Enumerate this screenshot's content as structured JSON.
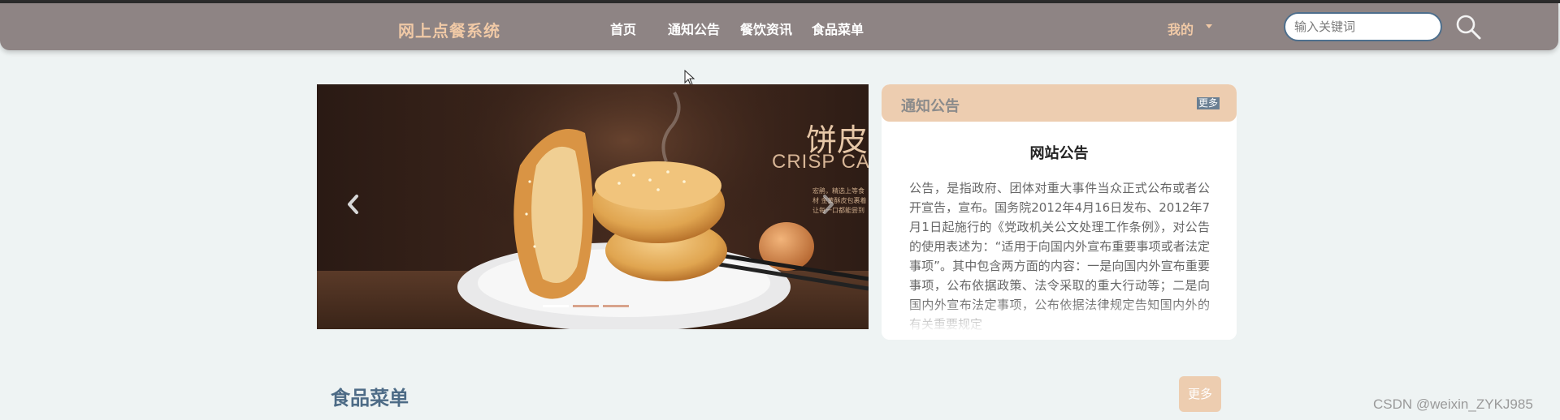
{
  "navbar": {
    "brand": "网上点餐系统",
    "items": [
      {
        "label": "首页"
      },
      {
        "label": "通知公告"
      },
      {
        "label": "餐饮资讯"
      },
      {
        "label": "食品菜单"
      }
    ],
    "user_menu": "我的",
    "search_placeholder": "输入关键词",
    "search_icon": "search-icon"
  },
  "carousel": {
    "slide_title_cn": "饼皮酥",
    "slide_title_en": "CRISP CAKE",
    "slide_desc": "宏鹃，精选上等食材 金黄酥皮包裹着 让每一口都能尝到",
    "prev_icon": "chevron-left-icon",
    "next_icon": "chevron-right-icon",
    "slide_count": 3,
    "active_slide": 1
  },
  "notice": {
    "header": "通知公告",
    "more": "更多",
    "title": "网站公告",
    "body": "公告，是指政府、团体对重大事件当众正式公布或者公开宣告，宣布。国务院2012年4月16日发布、2012年7月1日起施行的《党政机关公文处理工作条例》，对公告的使用表述为：“适用于向国内外宣布重要事项或者法定事项”。其中包含两方面的内容：一是向国内外宣布重要事项，公布依据政策、法令采取的重大行动等；二是向国内外宣布法定事项，公布依据法律规定告知国内外的有关重要规定"
  },
  "food_section": {
    "title": "食品菜单",
    "more": "更多"
  },
  "watermark": "CSDN @weixin_ZYKJ985",
  "colors": {
    "navbar_bg": "#8e8484",
    "brand": "#f0c9a6",
    "accent_peach": "#edcdb0",
    "section_title": "#4d6b86",
    "page_bg": "#eef3f3"
  }
}
